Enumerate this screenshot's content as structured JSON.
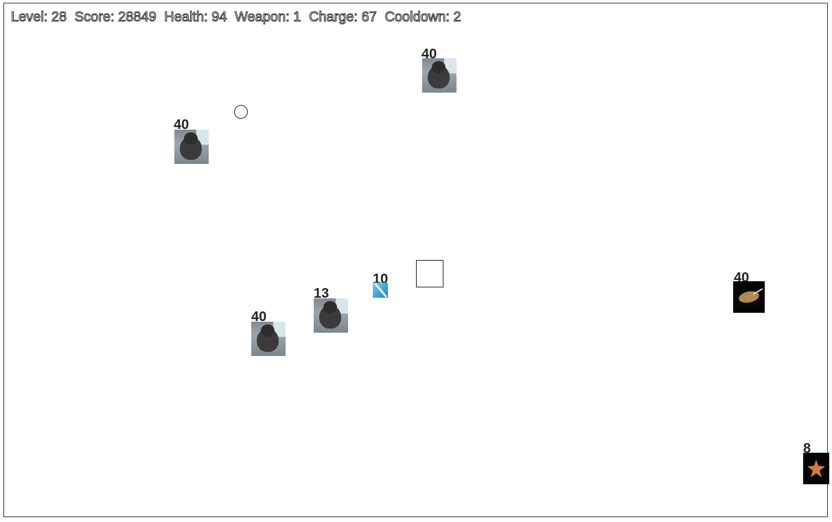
{
  "hud": {
    "level": "Level: 28",
    "score": "Score: 28849",
    "health": "Health: 94",
    "weapon": "Weapon: 1",
    "charge": "Charge: 67",
    "cooldown": "Cooldown: 2"
  },
  "entities": [
    {
      "hp": "40",
      "sprite": "walrus"
    },
    {
      "hp": "40",
      "sprite": "walrus"
    },
    {
      "hp": "40",
      "sprite": "walrus"
    },
    {
      "hp": "13",
      "sprite": "walrus"
    },
    {
      "hp": "10",
      "sprite": "blue-creature"
    },
    {
      "hp": "40",
      "sprite": "lobster"
    },
    {
      "hp": "8",
      "sprite": "starfish"
    }
  ],
  "player": {
    "shape": "square"
  },
  "pickup": {
    "shape": "circle"
  }
}
